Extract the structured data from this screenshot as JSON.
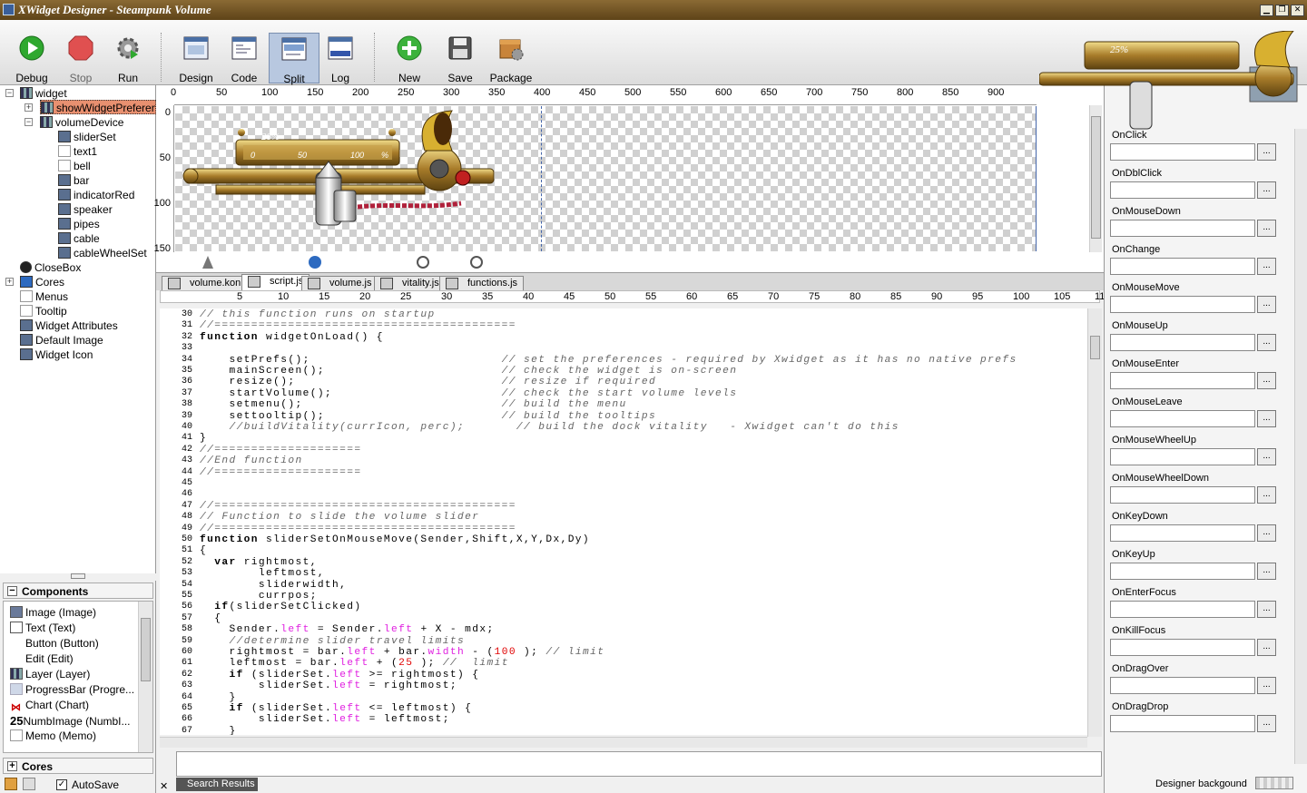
{
  "window": {
    "title": "XWidget Designer - Steampunk Volume"
  },
  "toolbar": {
    "debug": "Debug",
    "stop": "Stop",
    "run": "Run",
    "design": "Design",
    "code": "Code",
    "split": "Split",
    "log": "Log",
    "new": "New",
    "save": "Save",
    "package": "Package"
  },
  "tree": {
    "widget": "widget",
    "showWidgetPreferences": "showWidgetPreferenc",
    "volumeDevice": "volumeDevice",
    "children": [
      "sliderSet",
      "text1",
      "bell",
      "bar",
      "indicatorRed",
      "speaker",
      "pipes",
      "cable",
      "cableWheelSet"
    ],
    "closeBox": "CloseBox",
    "cores": "Cores",
    "menus": "Menus",
    "tooltip": "Tooltip",
    "widgetAttributes": "Widget Attributes",
    "defaultImage": "Default Image",
    "widgetIcon": "Widget Icon"
  },
  "components": {
    "title": "Components",
    "items": [
      "Image (Image)",
      "Text (Text)",
      "Button (Button)",
      "Edit (Edit)",
      "Layer (Layer)",
      "ProgressBar (Progre...",
      "Chart (Chart)",
      "NumbImage (NumbI...",
      "Memo (Memo)"
    ],
    "numbPrefix": "25"
  },
  "coresPanel": {
    "title": "Cores",
    "autosave": "AutoSave"
  },
  "ruler": {
    "h": [
      "0",
      "50",
      "100",
      "150",
      "200",
      "250",
      "300",
      "350",
      "400",
      "450",
      "500",
      "550",
      "600",
      "650",
      "700",
      "750",
      "800",
      "850",
      "900"
    ],
    "v": [
      "0",
      "50",
      "100",
      "150"
    ],
    "code": [
      "5",
      "10",
      "15",
      "20",
      "25",
      "30",
      "35",
      "40",
      "45",
      "50",
      "55",
      "60",
      "65",
      "70",
      "75",
      "80",
      "85",
      "90",
      "95",
      "100",
      "105",
      "11"
    ]
  },
  "widgetPreview": {
    "percent": "28%",
    "scale": [
      "0",
      "50",
      "100",
      "%"
    ],
    "percentRight": "25%"
  },
  "tabs": [
    "volume.kon",
    "script.js",
    "volume.js",
    "vitality.js",
    "functions.js"
  ],
  "code": {
    "startLine": 30,
    "lines": [
      "// this function runs on startup",
      "//=========================================",
      "function widgetOnLoad() {",
      "",
      "    setPrefs();                          // set the preferences - required by Xwidget as it has no native prefs",
      "    mainScreen();                        // check the widget is on-screen",
      "    resize();                            // resize if required",
      "    startVolume();                       // check the start volume levels",
      "    setmenu();                           // build the menu",
      "    settooltip();                        // build the tooltips",
      "    //buildVitality(currIcon, perc);       // build the dock vitality   - Xwidget can't do this",
      "}",
      "//====================",
      "//End function",
      "//====================",
      "",
      "",
      "//=========================================",
      "// Function to slide the volume slider",
      "//=========================================",
      "function sliderSetOnMouseMove(Sender,Shift,X,Y,Dx,Dy)",
      "{",
      "  var rightmost,",
      "        leftmost,",
      "        sliderwidth,",
      "        currpos;",
      "  if(sliderSetClicked)",
      "  {",
      "    Sender.left = Sender.left + X - mdx;",
      "    //determine slider travel limits",
      "    rightmost = bar.left + bar.width - (100 ); // limit",
      "    leftmost = bar.left + (25 ); //  limit",
      "    if (sliderSet.left >= rightmost) {",
      "        sliderSet.left = rightmost;",
      "    }",
      "    if (sliderSet.left <= leftmost) {",
      "        sliderSet.left = leftmost;",
      "    }"
    ]
  },
  "events": [
    "OnClick",
    "OnDblClick",
    "OnMouseDown",
    "OnChange",
    "OnMouseMove",
    "OnMouseUp",
    "OnMouseEnter",
    "OnMouseLeave",
    "OnMouseWheelUp",
    "OnMouseWheelDown",
    "OnKeyDown",
    "OnKeyUp",
    "OnEnterFocus",
    "OnKillFocus",
    "OnDragOver",
    "OnDragDrop"
  ],
  "eventButton": "...",
  "searchResults": "Search Results",
  "designerBackground": "Designer backgound"
}
